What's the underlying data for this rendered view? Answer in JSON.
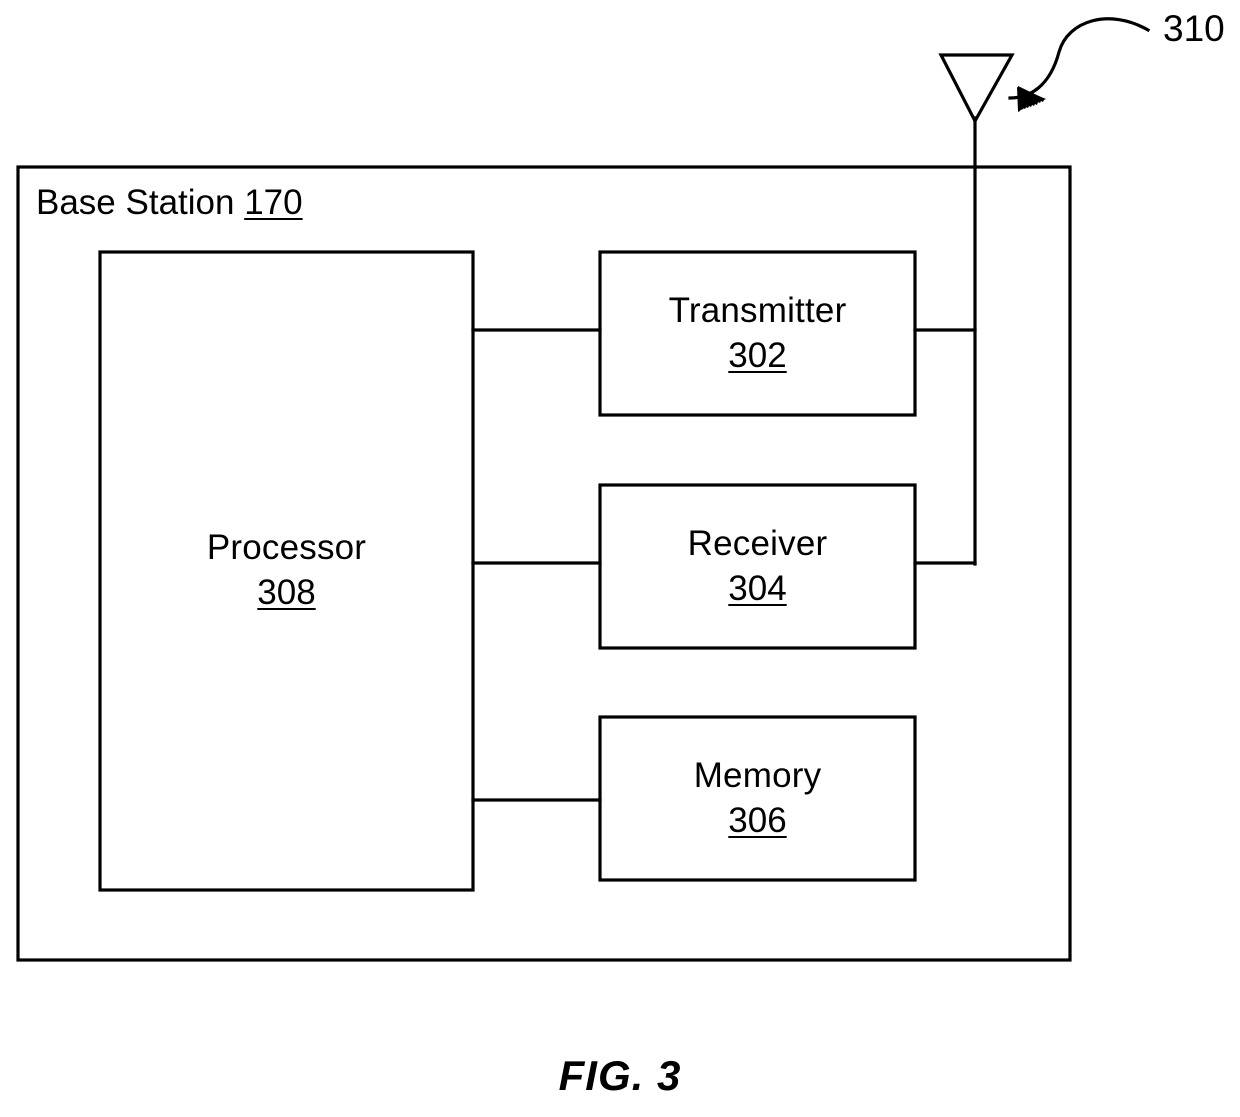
{
  "figure": {
    "caption": "FIG. 3",
    "stroke_color": "#000000",
    "background_color": "#ffffff"
  },
  "outer_container": {
    "name": "Base Station",
    "title": "Base Station",
    "reference_numeral": "170",
    "full_label": "Base Station 170"
  },
  "blocks": [
    {
      "id": "processor",
      "title": "Processor",
      "reference_numeral": "308"
    },
    {
      "id": "transmitter",
      "title": "Transmitter",
      "reference_numeral": "302"
    },
    {
      "id": "receiver",
      "title": "Receiver",
      "reference_numeral": "304"
    },
    {
      "id": "memory",
      "title": "Memory",
      "reference_numeral": "306"
    }
  ],
  "antenna": {
    "icon": "antenna-icon",
    "reference_numeral": "310",
    "leader": "curved-leader-line-with-arrowhead"
  },
  "connections": [
    {
      "from": "processor",
      "to": "transmitter"
    },
    {
      "from": "processor",
      "to": "receiver"
    },
    {
      "from": "processor",
      "to": "memory"
    },
    {
      "from": "transmitter",
      "to": "antenna"
    },
    {
      "from": "receiver",
      "to": "antenna"
    }
  ]
}
